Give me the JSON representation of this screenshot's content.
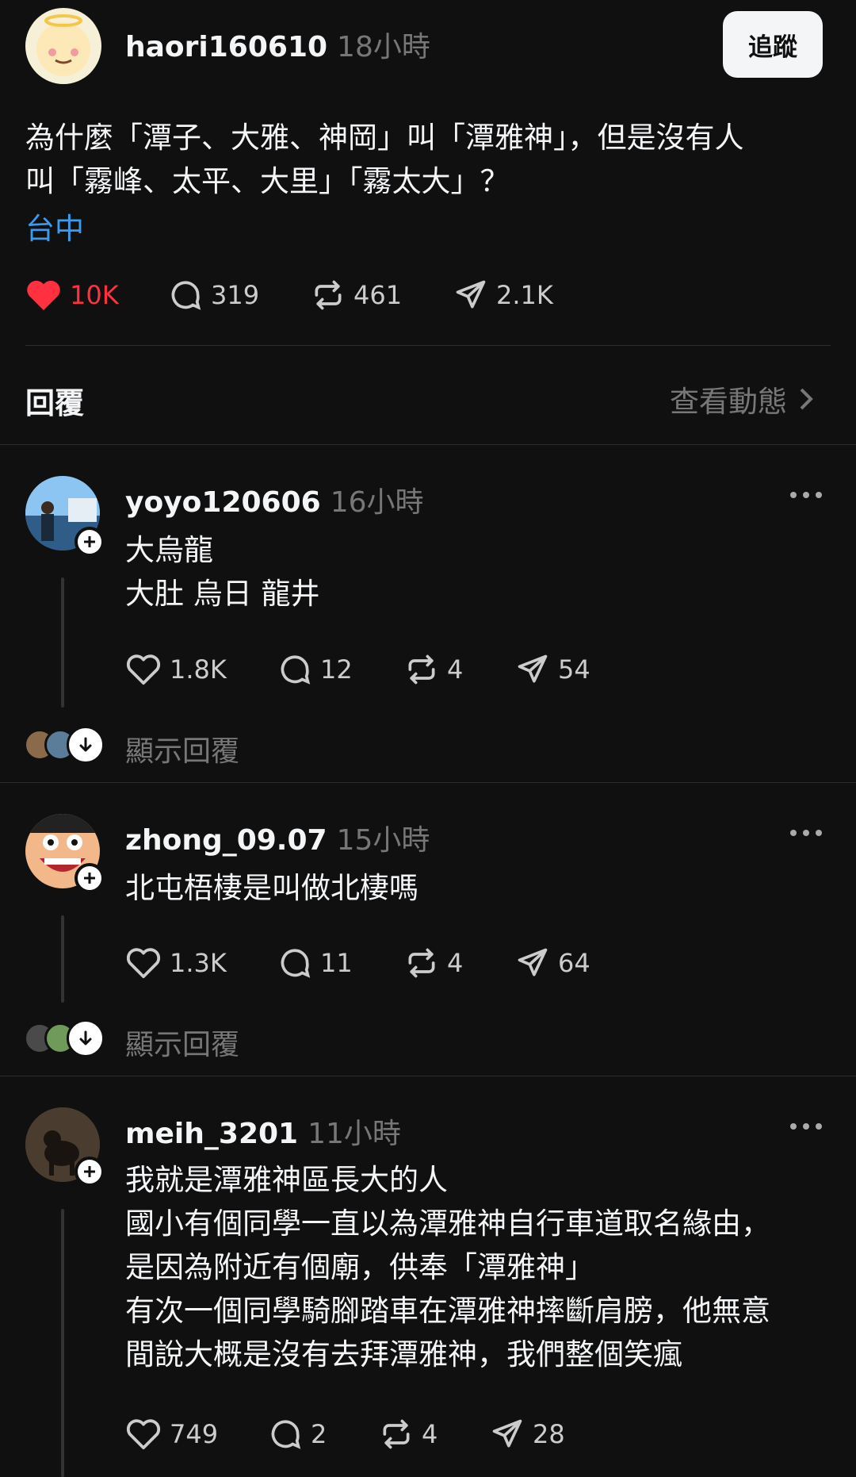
{
  "post": {
    "username": "haori160610",
    "time": "18小時",
    "follow_label": "追蹤",
    "text": "為什麼「潭子、大雅、神岡」叫「潭雅神」，但是沒有人\n叫「霧峰、太平、大里」「霧太大」？",
    "tag": "台中",
    "likes": "10K",
    "comments": "319",
    "reposts": "461",
    "shares": "2.1K",
    "liked": true
  },
  "replies_header": {
    "title": "回覆",
    "view_activity": "查看動態"
  },
  "replies": [
    {
      "username": "yoyo120606",
      "time": "16小時",
      "text": "大烏龍\n大肚 烏日 龍井",
      "likes": "1.8K",
      "comments": "12",
      "reposts": "4",
      "shares": "54",
      "show_replies": "顯示回覆"
    },
    {
      "username": "zhong_09.07",
      "time": "15小時",
      "text": "北屯梧棲是叫做北棲嗎",
      "likes": "1.3K",
      "comments": "11",
      "reposts": "4",
      "shares": "64",
      "show_replies": "顯示回覆"
    },
    {
      "username": "meih_3201",
      "time": "11小時",
      "text": "我就是潭雅神區長大的人\n國小有個同學一直以為潭雅神自行車道取名緣由，\n是因為附近有個廟，供奉「潭雅神」\n有次一個同學騎腳踏車在潭雅神摔斷肩膀，他無意\n間說大概是沒有去拜潭雅神，我們整個笑瘋",
      "likes": "749",
      "comments": "2",
      "reposts": "4",
      "shares": "28"
    }
  ],
  "colors": {
    "background": "#101010",
    "liked_red": "#ff3040",
    "tag_blue": "#3a9cf0",
    "muted": "#777777"
  },
  "icons": [
    "heart-icon",
    "comment-icon",
    "repost-icon",
    "share-icon",
    "more-icon",
    "plus-icon",
    "chevron-right-icon",
    "arrow-down-icon"
  ]
}
